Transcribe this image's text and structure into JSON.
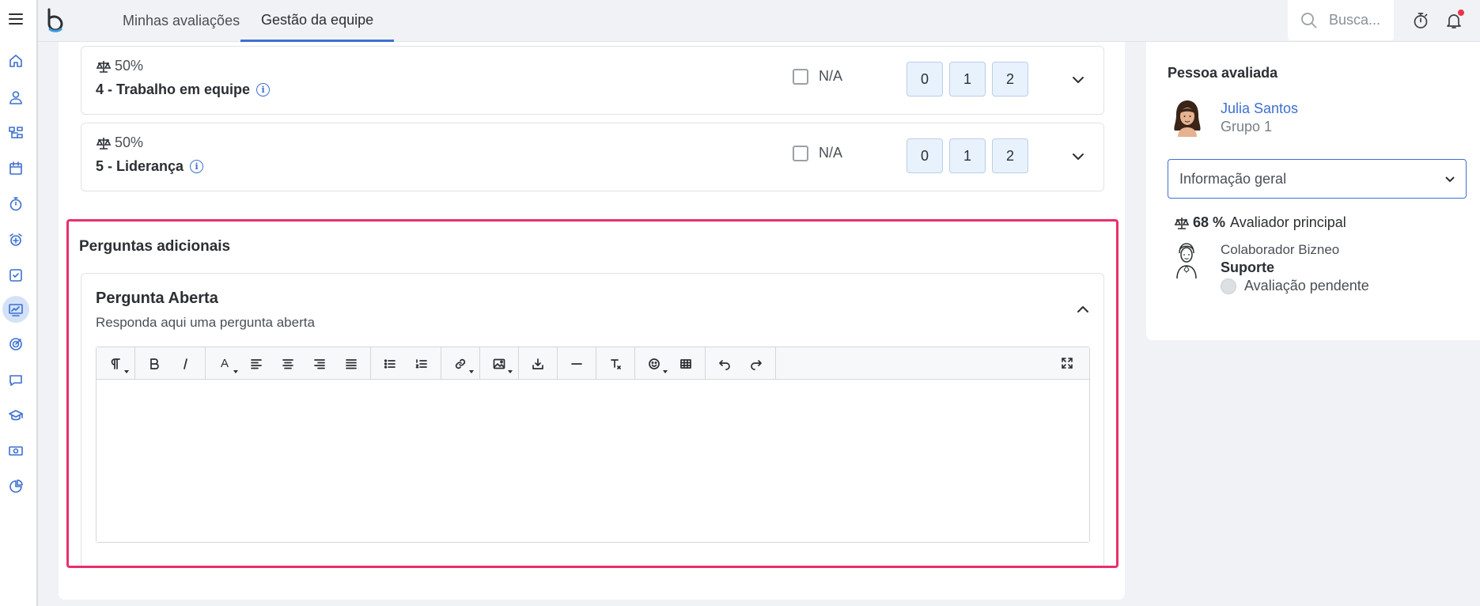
{
  "header": {
    "tabs": [
      {
        "label": "Minhas avaliações",
        "active": false
      },
      {
        "label": "Gestão da equipe",
        "active": true
      }
    ],
    "search_placeholder": "Busca..."
  },
  "sidebar": {
    "items": [
      {
        "icon": "home-icon"
      },
      {
        "icon": "user-icon"
      },
      {
        "icon": "org-chart-icon"
      },
      {
        "icon": "calendar-icon"
      },
      {
        "icon": "stopwatch-icon"
      },
      {
        "icon": "alarm-icon"
      },
      {
        "icon": "checkbox-icon"
      },
      {
        "icon": "performance-icon",
        "active": true
      },
      {
        "icon": "target-icon"
      },
      {
        "icon": "chat-icon"
      },
      {
        "icon": "graduation-icon"
      },
      {
        "icon": "money-icon"
      },
      {
        "icon": "pie-chart-icon"
      }
    ]
  },
  "criteria": [
    {
      "weight": "50%",
      "name": "4 - Trabalho em equipe",
      "na_label": "N/A",
      "scores": [
        "0",
        "1",
        "2"
      ]
    },
    {
      "weight": "50%",
      "name": "5 - Liderança",
      "na_label": "N/A",
      "scores": [
        "0",
        "1",
        "2"
      ]
    }
  ],
  "additional": {
    "title": "Perguntas adicionais",
    "question_title": "Pergunta Aberta",
    "question_desc": "Responda aqui uma pergunta aberta"
  },
  "editor": {
    "text_color_label": "A"
  },
  "right_panel": {
    "title": "Pessoa avaliada",
    "person_name": "Julia Santos",
    "person_group": "Grupo 1",
    "select_value": "Informação geral",
    "weight_value": "68 %",
    "weight_label": "Avaliador principal",
    "evaluator_role": "Colaborador Bizneo",
    "evaluator_dept": "Suporte",
    "status": "Avaliação pendente"
  },
  "colors": {
    "accent": "#3d6fd0",
    "highlight": "#e8306a",
    "notification": "#e8364a"
  }
}
